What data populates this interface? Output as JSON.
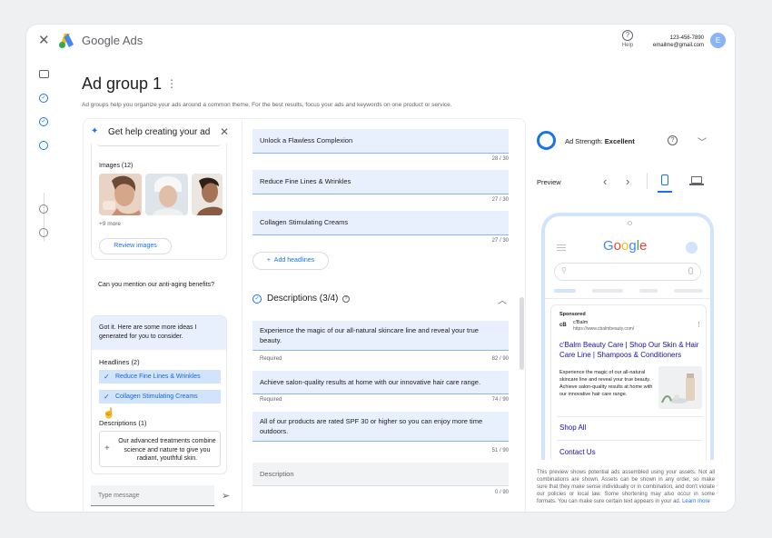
{
  "app": {
    "brand": "Google Ads",
    "help_label": "Help",
    "phone": "123-456-7890",
    "email": "emailme@gmail.com",
    "avatar_initial": "E"
  },
  "page": {
    "title": "Ad group 1",
    "menu_glyph": "⋮",
    "subtitle": "Ad groups help you organize your ads around a common theme. For the best results, focus your ads and keywords on one product or service."
  },
  "assistant": {
    "title": "Get help creating your ad",
    "images_label": "Images (12)",
    "more_label": "+9 more",
    "review_button": "Review images",
    "user_message": "Can you mention our anti-aging benefits?",
    "reply": "Got it. Here are some more ideas I generated for you to consider.",
    "headlines_label": "Headlines (2)",
    "headline_chips": [
      "Reduce Fine Lines & Wrinkles",
      "Collagen Stimulating Creams"
    ],
    "descriptions_label": "Descriptions (1)",
    "description_suggestion": "Our advanced treatments combine science and nature to give you radiant, youthful skin.",
    "message_placeholder": "Type message"
  },
  "headlines": [
    {
      "text": "Unlock a Flawless Complexion",
      "count": "28 / 30"
    },
    {
      "text": "Reduce Fine Lines & Wrinkles",
      "count": "27 / 30"
    },
    {
      "text": "Collagen Stimulating Creams",
      "count": "27 / 30"
    }
  ],
  "add_headlines": "Add headlines",
  "descriptions": {
    "title": "Descriptions (3/4)",
    "required_label": "Required",
    "items": [
      {
        "text": "Experience the magic of our all-natural skincare line and reveal your true beauty.",
        "count": "82 / 90"
      },
      {
        "text": "Achieve salon-quality results at home with our innovative hair care range.",
        "count": "74 / 90"
      },
      {
        "text": "All of our products are rated SPF 30 or higher so you can enjoy more time outdoors.",
        "count": "51 / 90"
      }
    ],
    "empty_placeholder": "Description",
    "empty_count": "0 / 90"
  },
  "preview": {
    "strength_label": "Ad Strength:",
    "strength_value": "Excellent",
    "preview_label": "Preview",
    "google_logo": "Google",
    "sponsored": "Sponsored",
    "favicon_text": "cB",
    "site_name": "c'Balm",
    "site_url": "https://www.cbalmbeauty.com/",
    "ad_title": "c'Balm Beauty Care | Shop Our Skin & Hair Care Line | Shampoos & Conditioners",
    "ad_body": "Experience the magic of our all-natural skincare line and reveal your true beauty. Achieve salon-quality results at home with our innovative hair care range.",
    "links": [
      "Shop All",
      "Contact Us"
    ],
    "disclaimer": "This preview shows potential ads assembled using your assets. Not all combinations are shown. Assets can be shown in any order, so make sure that they make sense individually or in combination, and don't violate our policies or local law. Some shortening may also occur in some formats. You can make sure certain text appears in your ad.",
    "learn_more": "Learn more"
  },
  "colors": {
    "accent": "#1a73e8",
    "field_bg": "#e8f0fe",
    "chip_bg": "#d2e3fc",
    "ad_link": "#1a0dab"
  }
}
